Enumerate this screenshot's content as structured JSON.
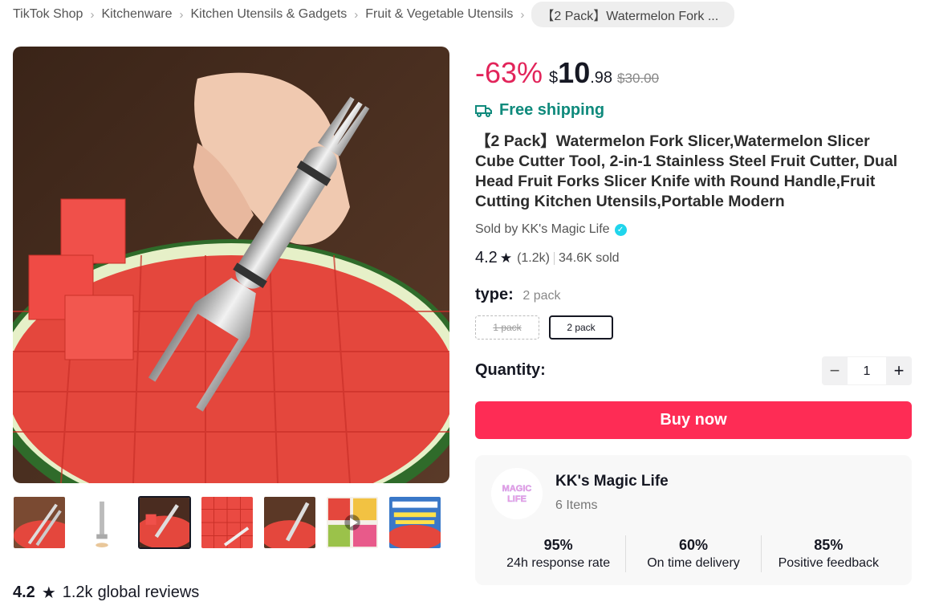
{
  "breadcrumb": {
    "items": [
      "TikTok Shop",
      "Kitchenware",
      "Kitchen Utensils & Gadgets",
      "Fruit & Vegetable Utensils"
    ],
    "current": "【2 Pack】Watermelon Fork ..."
  },
  "product": {
    "discount": "-63%",
    "currency": "$",
    "price_int": "10",
    "price_dec": ".98",
    "original_price": "$30.00",
    "shipping": "Free shipping",
    "title": "【2 Pack】Watermelon Fork Slicer,Watermelon Slicer Cube Cutter Tool, 2-in-1 Stainless Steel Fruit Cutter, Dual Head Fruit Forks Slicer Knife with Round Handle,Fruit Cutting Kitchen Utensils,Portable Modern",
    "sold_by": "Sold by KK's Magic Life",
    "rating": "4.2",
    "rating_count": "(1.2k)",
    "sold": "34.6K sold"
  },
  "variant": {
    "label": "type:",
    "selected": "2 pack",
    "options": [
      "1 pack",
      "2 pack"
    ]
  },
  "quantity": {
    "label": "Quantity:",
    "value": "1",
    "minus": "−",
    "plus": "+"
  },
  "buy_button": "Buy now",
  "shop": {
    "avatar_text": "MAGIC LIFE",
    "name": "KK's Magic Life",
    "items": "6 Items",
    "stats": [
      {
        "value": "95%",
        "label": "24h response rate"
      },
      {
        "value": "60%",
        "label": "On time delivery"
      },
      {
        "value": "85%",
        "label": "Positive feedback"
      }
    ]
  },
  "reviews": {
    "rating": "4.2",
    "count": "1.2k",
    "label": "global reviews"
  },
  "thumbnails": [
    "thumb-1",
    "thumb-2",
    "thumb-3",
    "thumb-4",
    "thumb-5",
    "thumb-6",
    "thumb-7"
  ],
  "selected_thumbnail": 3,
  "colors": {
    "accent": "#fe2c55",
    "discount": "#e2245a",
    "shipping": "#0f8a7c",
    "verified": "#20d5ec"
  }
}
